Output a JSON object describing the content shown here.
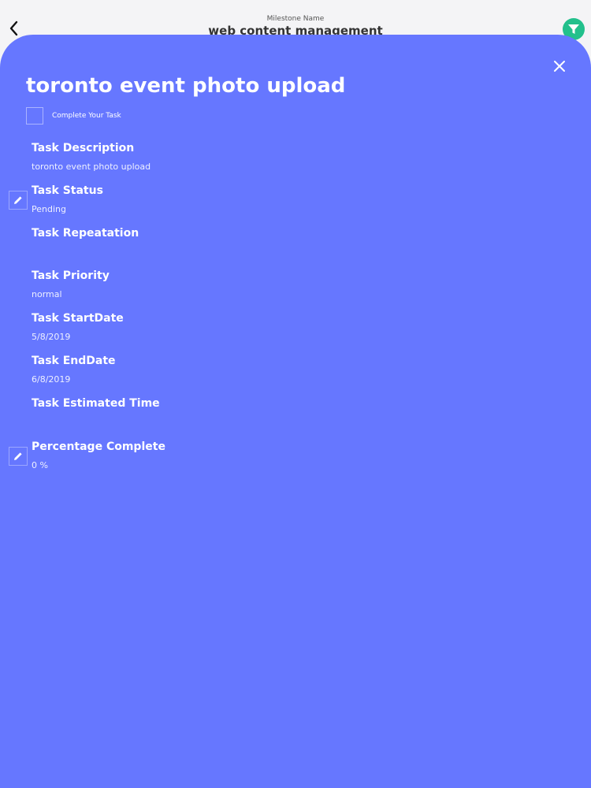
{
  "header": {
    "subtitle": "Milestone Name",
    "title": "web content management"
  },
  "task": {
    "title": "toronto event photo upload",
    "complete_label": "Complete Your Task",
    "fields": {
      "description": {
        "label": "Task Description",
        "value": "toronto event photo upload"
      },
      "status": {
        "label": "Task Status",
        "value": "Pending"
      },
      "repeatation": {
        "label": "Task Repeatation",
        "value": ""
      },
      "priority": {
        "label": "Task Priority",
        "value": "normal"
      },
      "start_date": {
        "label": "Task StartDate",
        "value": "5/8/2019"
      },
      "end_date": {
        "label": "Task EndDate",
        "value": "6/8/2019"
      },
      "estimated_time": {
        "label": "Task Estimated Time",
        "value": ""
      },
      "percentage": {
        "label": "Percentage Complete",
        "value": "0 %"
      }
    }
  },
  "icons": {
    "back": "chevron-left-icon",
    "filter": "filter-icon",
    "close": "close-icon",
    "edit": "pencil-icon"
  },
  "colors": {
    "sheet_background": "#6677ff",
    "filter_button": "#22c08c",
    "header_background": "#f4f4f6"
  }
}
